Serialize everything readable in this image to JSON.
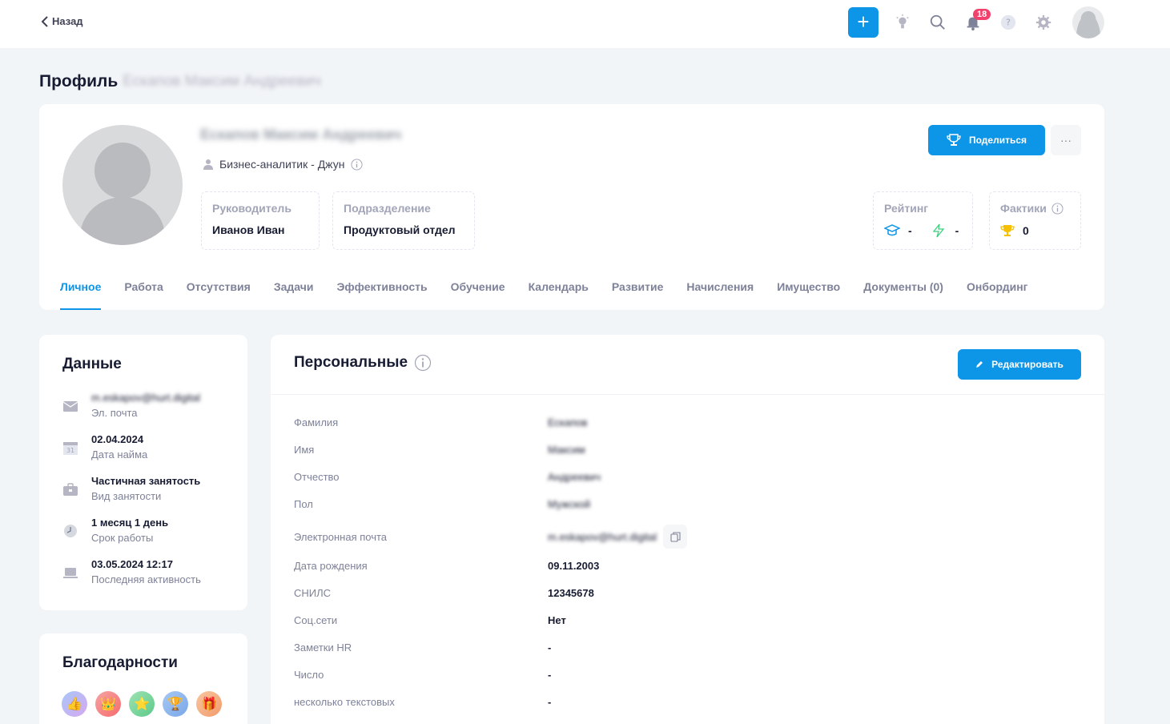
{
  "topbar": {
    "back_label": "Назад",
    "notifications_count": "18"
  },
  "page": {
    "title": "Профиль",
    "title_name": "Ескапов Максим Андреевич"
  },
  "profile": {
    "full_name": "Ескапов Максим Андреевич",
    "position": "Бизнес-аналитик  - Джун",
    "share_label": "Поделиться",
    "more_label": "···",
    "manager_label": "Руководитель",
    "manager_value": "Иванов Иван",
    "department_label": "Подразделение",
    "department_value": "Продуктовый отдел",
    "rating_label": "Рейтинг",
    "rating_edu": "-",
    "rating_energy": "-",
    "facts_label": "Фактики",
    "facts_value": "0"
  },
  "tabs": [
    {
      "label": "Личное"
    },
    {
      "label": "Работа"
    },
    {
      "label": "Отсутствия"
    },
    {
      "label": "Задачи"
    },
    {
      "label": "Эффективность"
    },
    {
      "label": "Обучение"
    },
    {
      "label": "Календарь"
    },
    {
      "label": "Развитие"
    },
    {
      "label": "Начисления"
    },
    {
      "label": "Имущество"
    },
    {
      "label": "Документы (0)"
    },
    {
      "label": "Онбординг"
    }
  ],
  "data_card": {
    "title": "Данные",
    "rows": [
      {
        "value": "m.eskapov@hurt.digital",
        "label": "Эл. почта"
      },
      {
        "value": "02.04.2024",
        "label": "Дата найма"
      },
      {
        "value": "Частичная занятость",
        "label": "Вид занятости"
      },
      {
        "value": "1 месяц 1 день",
        "label": "Срок работы"
      },
      {
        "value": "03.05.2024 12:17",
        "label": "Последняя активность"
      }
    ]
  },
  "thanks_card": {
    "title": "Благодарности"
  },
  "personal": {
    "title": "Персональные",
    "edit_label": "Редактировать",
    "fields": [
      {
        "label": "Фамилия",
        "value": "Ескапов"
      },
      {
        "label": "Имя",
        "value": "Максим"
      },
      {
        "label": "Отчество",
        "value": "Андреевич"
      },
      {
        "label": "Пол",
        "value": "Мужской"
      },
      {
        "label": "Электронная почта",
        "value": "m.eskapov@hurt.digital"
      },
      {
        "label": "Дата рождения",
        "value": "09.11.2003"
      },
      {
        "label": "СНИЛС",
        "value": "12345678"
      },
      {
        "label": "Соц.сети",
        "value": "Нет"
      },
      {
        "label": "Заметки HR",
        "value": "-"
      },
      {
        "label": "Число",
        "value": "-"
      },
      {
        "label": "несколько текстовых",
        "value": "-"
      }
    ]
  },
  "colors": {
    "accent": "#0d95e8",
    "badge": "#f1416c",
    "background": "#f2f5f8"
  }
}
